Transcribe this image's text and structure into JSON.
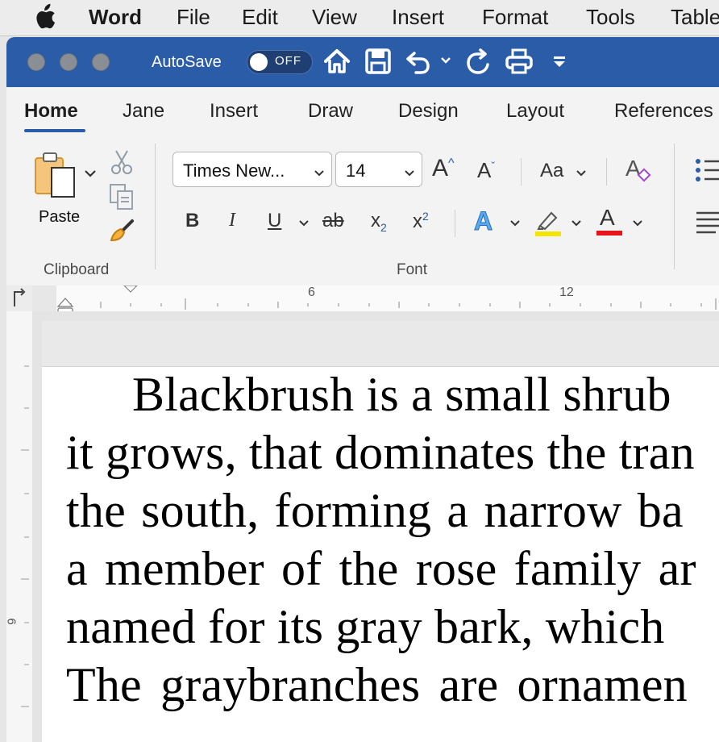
{
  "menubar": {
    "app_name": "Word",
    "items": [
      "File",
      "Edit",
      "View",
      "Insert",
      "Format",
      "Tools",
      "Table"
    ]
  },
  "titlebar": {
    "autosave_label": "AutoSave",
    "toggle_state": "OFF"
  },
  "tabs": [
    "Home",
    "Jane",
    "Insert",
    "Draw",
    "Design",
    "Layout",
    "References"
  ],
  "active_tab": "Home",
  "clipboard": {
    "paste_label": "Paste",
    "group_label": "Clipboard"
  },
  "font": {
    "font_name": "Times New...",
    "font_size": "14",
    "grow_label": "A",
    "shrink_label": "A",
    "case_label": "Aa",
    "bold_label": "B",
    "italic_label": "I",
    "underline_label": "U",
    "strike_label": "ab",
    "subscript_label": "x",
    "subscript_mark": "2",
    "superscript_label": "x",
    "superscript_mark": "2",
    "effects_label": "A",
    "font_color_label": "A",
    "group_label": "Font",
    "highlight_color": "#f5e400",
    "font_color": "#e8141b"
  },
  "ruler": {
    "marks": [
      "6",
      "12"
    ],
    "vertical_mark": "6"
  },
  "document": {
    "lines": [
      "Blackbrush is a small shrub",
      "it grows, that dominates the tran",
      "the south,  forming  a narrow ba",
      "a  member  of the  rose  family  ar",
      "named for its gray bark, which",
      "The graybranches  are  ornamen"
    ]
  },
  "colors": {
    "titlebar": "#2a5ca8",
    "accent": "#2a5ca8"
  }
}
